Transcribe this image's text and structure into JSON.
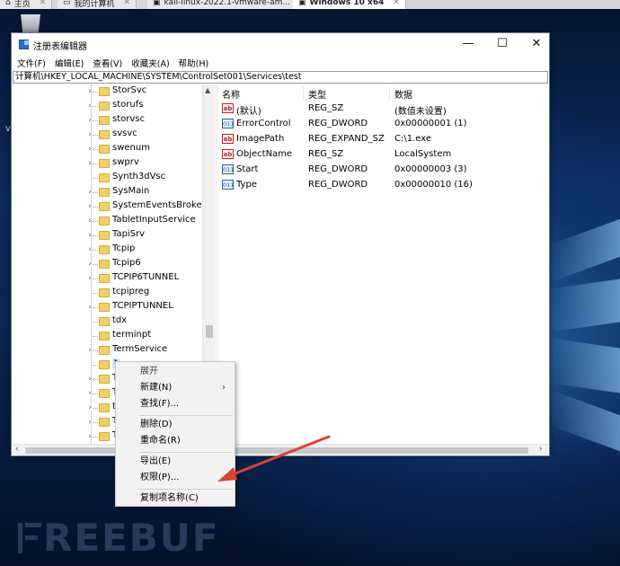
{
  "vm_tabs": [
    {
      "label": "主页",
      "active": false
    },
    {
      "label": "我的计算机",
      "active": false
    },
    {
      "label": "kali-linux-2022.1-vmware-am...",
      "active": false
    },
    {
      "label": "Windows 10 x64",
      "active": true
    }
  ],
  "desktop": {
    "edge_letter": "v"
  },
  "window": {
    "title": "注册表编辑器",
    "controls": {
      "minimize": "—",
      "maximize": "☐",
      "close": "✕"
    }
  },
  "menu": [
    "文件(F)",
    "编辑(E)",
    "查看(V)",
    "收藏夹(A)",
    "帮助(H)"
  ],
  "address": "计算机\\HKEY_LOCAL_MACHINE\\SYSTEM\\ControlSet001\\Services\\test",
  "tree": [
    {
      "label": "StorSvc",
      "expandable": true
    },
    {
      "label": "storufs",
      "expandable": true
    },
    {
      "label": "storvsc",
      "expandable": true
    },
    {
      "label": "svsvc",
      "expandable": true
    },
    {
      "label": "swenum",
      "expandable": true
    },
    {
      "label": "swprv",
      "expandable": true
    },
    {
      "label": "Synth3dVsc",
      "expandable": false
    },
    {
      "label": "SysMain",
      "expandable": true
    },
    {
      "label": "SystemEventsBroker",
      "expandable": true
    },
    {
      "label": "TabletInputService",
      "expandable": true
    },
    {
      "label": "TapiSrv",
      "expandable": true
    },
    {
      "label": "Tcpip",
      "expandable": true
    },
    {
      "label": "Tcpip6",
      "expandable": true
    },
    {
      "label": "TCPIP6TUNNEL",
      "expandable": true
    },
    {
      "label": "tcpipreg",
      "expandable": false
    },
    {
      "label": "TCPIPTUNNEL",
      "expandable": true
    },
    {
      "label": "tdx",
      "expandable": false
    },
    {
      "label": "terminpt",
      "expandable": false
    },
    {
      "label": "TermService",
      "expandable": true
    },
    {
      "label": "t",
      "expandable": false,
      "selected": true
    },
    {
      "label": "T",
      "expandable": true
    },
    {
      "label": "T",
      "expandable": true
    },
    {
      "label": "t",
      "expandable": true
    },
    {
      "label": "T",
      "expandable": true
    },
    {
      "label": "T",
      "expandable": true
    }
  ],
  "list": {
    "headers": {
      "name": "名称",
      "type": "类型",
      "data": "数据"
    },
    "rows": [
      {
        "icon": "string-value-icon",
        "name": "(默认)",
        "type": "REG_SZ",
        "data": "(数值未设置)"
      },
      {
        "icon": "binary-value-icon",
        "name": "ErrorControl",
        "type": "REG_DWORD",
        "data": "0x00000001 (1)"
      },
      {
        "icon": "string-value-icon",
        "name": "ImagePath",
        "type": "REG_EXPAND_SZ",
        "data": "C:\\1.exe"
      },
      {
        "icon": "string-value-icon",
        "name": "ObjectName",
        "type": "REG_SZ",
        "data": "LocalSystem"
      },
      {
        "icon": "binary-value-icon",
        "name": "Start",
        "type": "REG_DWORD",
        "data": "0x00000003 (3)"
      },
      {
        "icon": "binary-value-icon",
        "name": "Type",
        "type": "REG_DWORD",
        "data": "0x00000010 (16)"
      }
    ]
  },
  "context_menu": {
    "expand": "展开",
    "new": "新建(N)",
    "find": "查找(F)...",
    "delete": "删除(D)",
    "rename": "重命名(R)",
    "export": "导出(E)",
    "permissions": "权限(P)...",
    "copy_key_name": "复制项名称(C)",
    "submenu_arrow": "›"
  },
  "annotation": {
    "arrow_color": "#d9413a"
  },
  "watermark": "REEBUF"
}
